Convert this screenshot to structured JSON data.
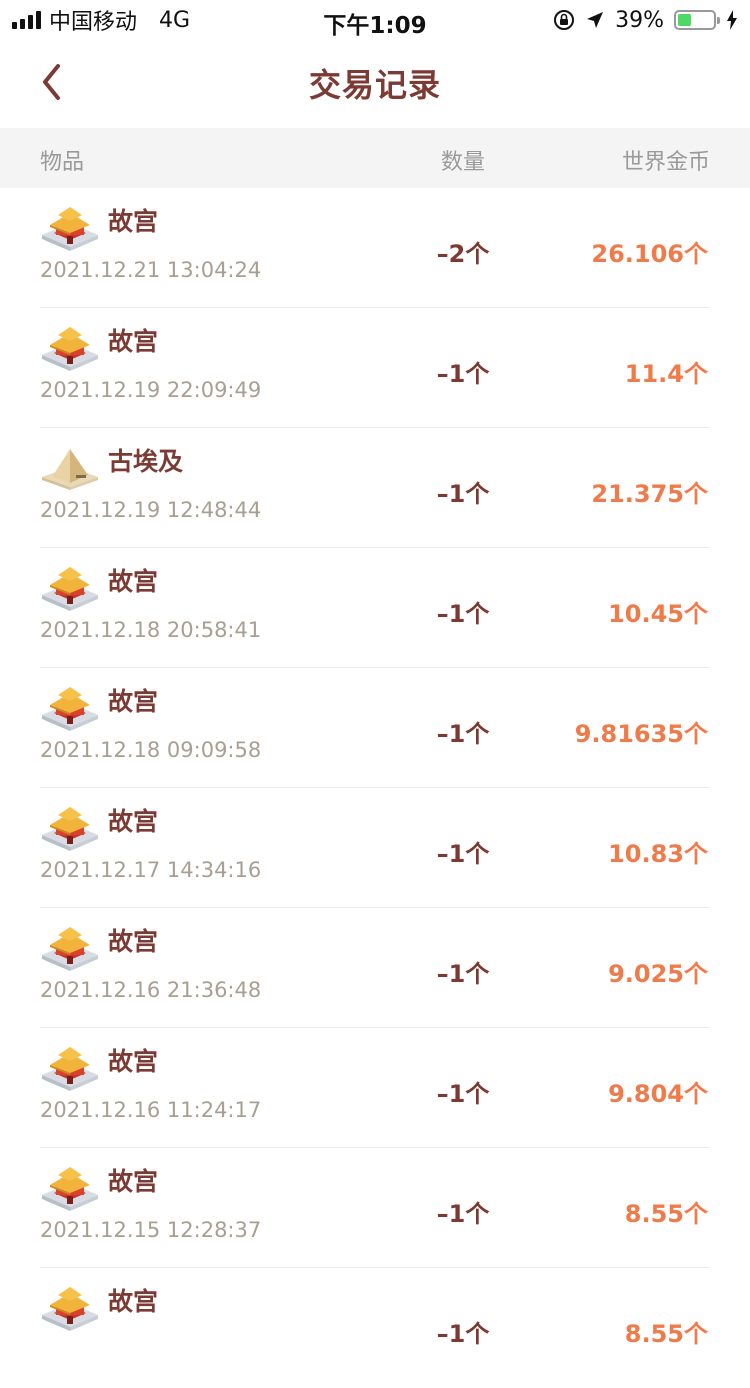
{
  "status_bar": {
    "carrier": "中国移动",
    "network": "4G",
    "time": "下午1:09",
    "battery_pct": "39%",
    "battery_level": 0.39,
    "battery_color": "#4cd964",
    "icons": [
      "signal-icon",
      "orientation-lock-icon",
      "location-icon",
      "battery-icon",
      "charging-icon"
    ]
  },
  "header": {
    "back_icon": "chevron-left-icon",
    "title": "交易记录"
  },
  "columns": {
    "item": "物品",
    "quantity": "数量",
    "gold": "世界金币"
  },
  "colors": {
    "title": "#7b3a33",
    "gold": "#ef7a4a",
    "timestamp": "#a89f93"
  },
  "records": [
    {
      "name": "故宫",
      "icon": "forbidden-city-icon",
      "time": "2021.12.21 13:04:24",
      "qty": "–2个",
      "gold": "26.106个"
    },
    {
      "name": "故宫",
      "icon": "forbidden-city-icon",
      "time": "2021.12.19 22:09:49",
      "qty": "–1个",
      "gold": "11.4个"
    },
    {
      "name": "古埃及",
      "icon": "pyramid-icon",
      "time": "2021.12.19 12:48:44",
      "qty": "–1个",
      "gold": "21.375个"
    },
    {
      "name": "故宫",
      "icon": "forbidden-city-icon",
      "time": "2021.12.18 20:58:41",
      "qty": "–1个",
      "gold": "10.45个"
    },
    {
      "name": "故宫",
      "icon": "forbidden-city-icon",
      "time": "2021.12.18 09:09:58",
      "qty": "–1个",
      "gold": "9.81635个"
    },
    {
      "name": "故宫",
      "icon": "forbidden-city-icon",
      "time": "2021.12.17 14:34:16",
      "qty": "–1个",
      "gold": "10.83个"
    },
    {
      "name": "故宫",
      "icon": "forbidden-city-icon",
      "time": "2021.12.16 21:36:48",
      "qty": "–1个",
      "gold": "9.025个"
    },
    {
      "name": "故宫",
      "icon": "forbidden-city-icon",
      "time": "2021.12.16 11:24:17",
      "qty": "–1个",
      "gold": "9.804个"
    },
    {
      "name": "故宫",
      "icon": "forbidden-city-icon",
      "time": "2021.12.15 12:28:37",
      "qty": "–1个",
      "gold": "8.55个"
    },
    {
      "name": "故宫",
      "icon": "forbidden-city-icon",
      "time": "",
      "qty": "–1个",
      "gold": "8.55个"
    }
  ]
}
